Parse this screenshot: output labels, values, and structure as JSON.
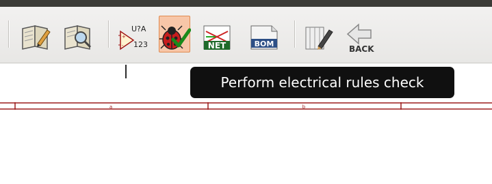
{
  "window": {
    "title_bar_color": "#3c3b37"
  },
  "toolbar": {
    "buttons": [
      {
        "name": "edit-component-library-button",
        "icon": "book-pencil-icon"
      },
      {
        "name": "browse-library-button",
        "icon": "book-magnifier-icon"
      },
      {
        "name": "annotate-schematic-button",
        "icon": "annotate-icon",
        "label_top": "U?A",
        "label_bottom": "123"
      },
      {
        "name": "erc-button",
        "icon": "ladybug-check-icon",
        "active": true
      },
      {
        "name": "generate-netlist-button",
        "icon": "netlist-icon",
        "label": "NET"
      },
      {
        "name": "generate-bom-button",
        "icon": "bom-icon",
        "label": "BOM"
      },
      {
        "name": "run-pcbnew-button",
        "icon": "pcb-pencil-icon"
      },
      {
        "name": "back-button",
        "icon": "back-arrow-icon",
        "label": "BACK"
      }
    ],
    "active_color": "#f7c6a8"
  },
  "tooltip": {
    "text": "Perform electrical rules check"
  },
  "sheet": {
    "border_color": "#9b1b1b",
    "zone_labels": [
      "a",
      "b"
    ]
  }
}
